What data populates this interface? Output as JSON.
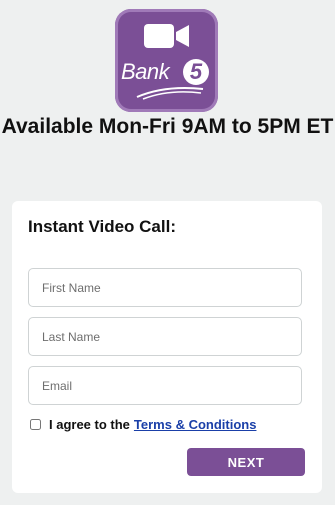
{
  "brand": {
    "logo_text": "Bank",
    "logo_number": "5",
    "logo_color": "#7b4f96",
    "camera_icon": "video-camera-icon"
  },
  "headline": "Available Mon-Fri 9AM to 5PM ET",
  "form": {
    "title": "Instant Video Call:",
    "first_name": {
      "placeholder": "First Name",
      "value": ""
    },
    "last_name": {
      "placeholder": "Last Name",
      "value": ""
    },
    "email": {
      "placeholder": "Email",
      "value": ""
    },
    "agree": {
      "prefix": "I agree to the",
      "link_text": "Terms & Conditions",
      "checked": false
    },
    "submit_label": "NEXT"
  },
  "colors": {
    "accent": "#7b4f96",
    "link": "#1a3fa8",
    "background": "#eef0f0"
  }
}
